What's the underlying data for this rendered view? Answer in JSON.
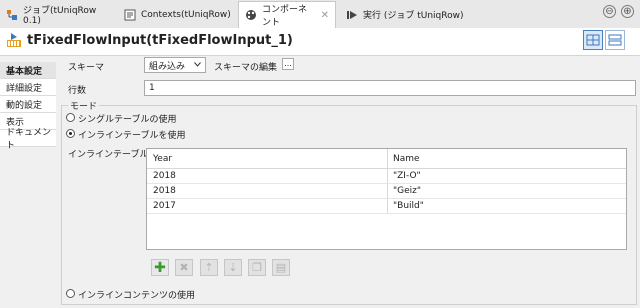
{
  "tabs": [
    {
      "label": "ジョブ(tUniqRow 0.1)",
      "icon": "job-icon",
      "active": false
    },
    {
      "label": "Contexts(tUniqRow)",
      "icon": "contexts-icon",
      "active": false
    },
    {
      "label": "コンポーネント",
      "icon": "component-palette-icon",
      "active": true
    },
    {
      "label": "実行 (ジョブ tUniqRow)",
      "icon": "run-icon",
      "active": false
    }
  ],
  "window_controls": {
    "minimize": "⊖",
    "maximize": "⊕"
  },
  "component": {
    "title": "tFixedFlowInput(tFixedFlowInput_1)",
    "icon": "fixed-flow-input-icon"
  },
  "nav": {
    "items": [
      {
        "label": "基本設定",
        "active": true
      },
      {
        "label": "詳細設定",
        "active": false
      },
      {
        "label": "動的設定",
        "active": false
      },
      {
        "label": "表示",
        "active": false
      },
      {
        "label": "ドキュメント",
        "active": false
      }
    ]
  },
  "form": {
    "schema_label": "スキーマ",
    "schema_value": "組み込み",
    "edit_schema_label": "スキーマの編集",
    "edit_schema_button": "...",
    "rows_label": "行数",
    "rows_value": "1",
    "mode_label": "モード",
    "mode_options": [
      {
        "label": "シングルテーブルの使用",
        "selected": false
      },
      {
        "label": "インラインテーブルを使用",
        "selected": true
      },
      {
        "label": "インラインコンテンツの使用",
        "selected": false
      }
    ],
    "inline_table_label": "インラインテーブル"
  },
  "table": {
    "columns": [
      "Year",
      "Name"
    ],
    "rows": [
      [
        "2018",
        "\"ZI-O\""
      ],
      [
        "2018",
        "\"Geiz\""
      ],
      [
        "2017",
        "\"Build\""
      ]
    ]
  },
  "table_toolbar": [
    {
      "icon": "add-row-icon",
      "enabled": true
    },
    {
      "icon": "delete-row-icon",
      "enabled": false
    },
    {
      "icon": "move-up-icon",
      "enabled": false
    },
    {
      "icon": "move-down-icon",
      "enabled": false
    },
    {
      "icon": "copy-icon",
      "enabled": false
    },
    {
      "icon": "paste-icon",
      "enabled": false
    }
  ],
  "colors": {
    "accent": "#4a7fc1",
    "add_green": "#3a9a2e",
    "panel_bg": "#f0f0f0"
  }
}
